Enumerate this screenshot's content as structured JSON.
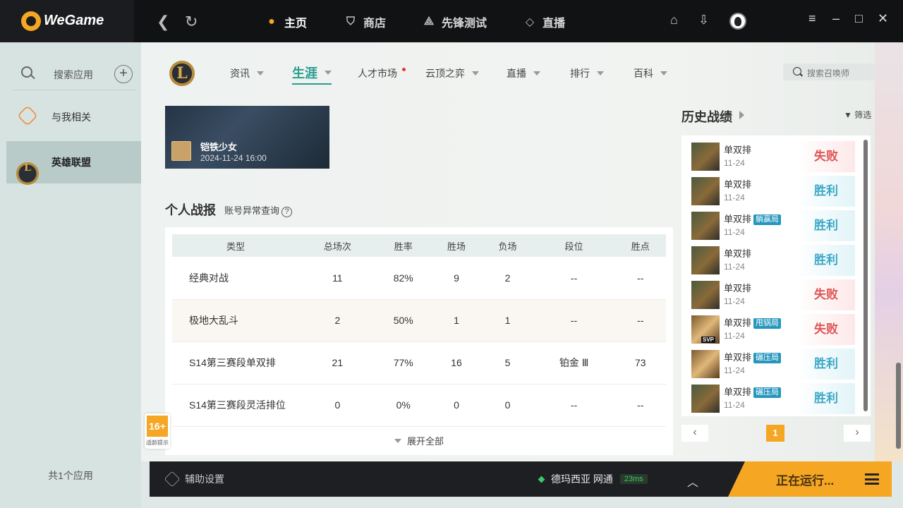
{
  "app": {
    "brand": "WeGame",
    "top_nav": [
      {
        "label": "主页",
        "icon": "home-icon",
        "active": true
      },
      {
        "label": "商店",
        "icon": "store-bag-icon",
        "active": false
      },
      {
        "label": "先锋测试",
        "icon": "pioneer-test-icon",
        "active": false
      },
      {
        "label": "直播",
        "icon": "live-icon",
        "active": false
      }
    ]
  },
  "sidebar": {
    "search_label": "搜索应用",
    "items": [
      {
        "label": "与我相关",
        "icon": "related-to-me-icon"
      },
      {
        "label": "英雄联盟",
        "icon": "league-of-legends-icon",
        "active": true
      }
    ],
    "footer": "共1个应用"
  },
  "game_nav": {
    "items": [
      {
        "label": "资讯",
        "dropdown": true
      },
      {
        "label": "生涯",
        "dropdown": true,
        "active": true
      },
      {
        "label": "人才市场",
        "dot": true
      },
      {
        "label": "云顶之弈",
        "dropdown": true
      },
      {
        "label": "直播",
        "dropdown": true
      },
      {
        "label": "排行",
        "dropdown": true
      },
      {
        "label": "百科",
        "dropdown": true
      }
    ],
    "search_placeholder": "搜索召唤师"
  },
  "video": {
    "title": "铠铁少女",
    "date": "2024-11-24 16:00"
  },
  "personal": {
    "title": "个人战报",
    "link": "账号异常查询",
    "columns": [
      "类型",
      "总场次",
      "胜率",
      "胜场",
      "负场",
      "段位",
      "胜点"
    ],
    "rows": [
      [
        "经典对战",
        "11",
        "82%",
        "9",
        "2",
        "--",
        "--"
      ],
      [
        "极地大乱斗",
        "2",
        "50%",
        "1",
        "1",
        "--",
        "--"
      ],
      [
        "S14第三赛段单双排",
        "21",
        "77%",
        "16",
        "5",
        "铂金 Ⅲ",
        "73"
      ],
      [
        "S14第三赛段灵活排位",
        "0",
        "0%",
        "0",
        "0",
        "--",
        "--"
      ]
    ],
    "expand_label": "展开全部"
  },
  "age_badge": {
    "num": "16+",
    "text": "适龄提示"
  },
  "history": {
    "title": "历史战绩",
    "filter_label": "筛选",
    "matches": [
      {
        "mode": "单双排",
        "tag": "",
        "date": "11-24",
        "result": "失败",
        "win": false
      },
      {
        "mode": "单双排",
        "tag": "",
        "date": "11-24",
        "result": "胜利",
        "win": true
      },
      {
        "mode": "单双排",
        "tag": "躺赢局",
        "date": "11-24",
        "result": "胜利",
        "win": true
      },
      {
        "mode": "单双排",
        "tag": "",
        "date": "11-24",
        "result": "胜利",
        "win": true
      },
      {
        "mode": "单双排",
        "tag": "",
        "date": "11-24",
        "result": "失败",
        "win": false
      },
      {
        "mode": "单双排",
        "tag": "甩锅局",
        "date": "11-24",
        "result": "失败",
        "win": false,
        "svp": "SVP"
      },
      {
        "mode": "单双排",
        "tag": "碾压局",
        "date": "11-24",
        "result": "胜利",
        "win": true
      },
      {
        "mode": "单双排",
        "tag": "碾压局",
        "date": "11-24",
        "result": "胜利",
        "win": true
      }
    ],
    "page": "1"
  },
  "bottom": {
    "assist_label": "辅助设置",
    "server": "德玛西亚 网通",
    "ping": "23ms",
    "running_label": "正在运行..."
  },
  "colors": {
    "accent": "#f5a623",
    "active_tab": "#2a9d8f",
    "win": "#3aa8c6",
    "lose": "#e05555"
  }
}
